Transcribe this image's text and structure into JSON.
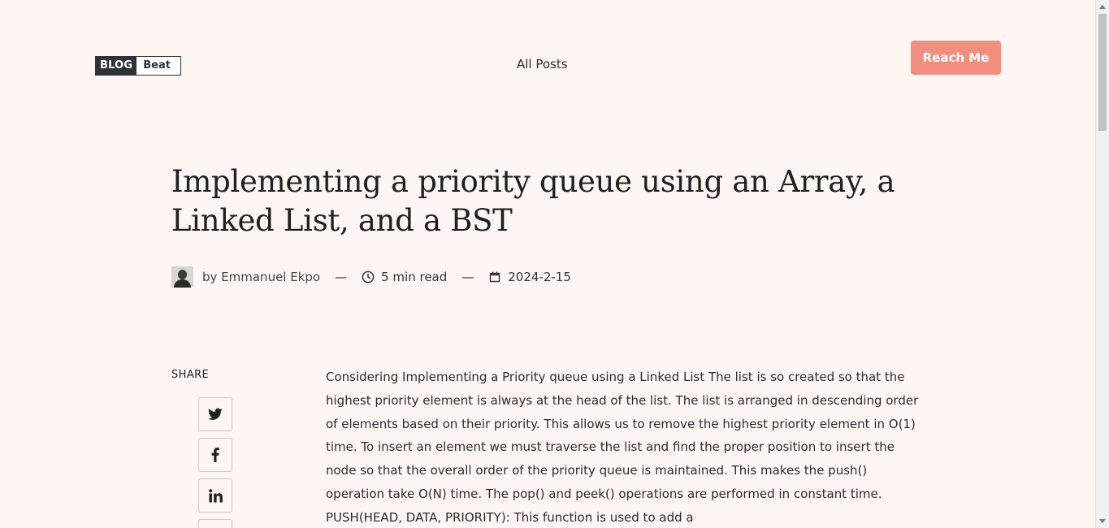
{
  "header": {
    "logo_part1": "BLOG",
    "logo_part2": "Beat",
    "nav_all_posts": "All Posts",
    "reach_button": "Reach Me"
  },
  "post": {
    "title": "Implementing a priority queue using an Array, a Linked List, and a BST",
    "author": "by Emmanuel Ekpo",
    "separator": "—",
    "read_time": "5 min read",
    "date": "2024-2-15",
    "body": "Considering Implementing a Priority queue using a Linked List The list is so created so that the highest priority element is always at the head of the list. The list is arranged in descending order of elements based on their priority. This allows us to remove the highest priority element in O(1) time. To insert an element we must traverse the list and find the proper position to insert the node so that the overall order of the priority queue is maintained. This makes the push() operation take O(N) time. The pop() and peek() operations are performed in constant time. PUSH(HEAD, DATA, PRIORITY): This function is used to add a"
  },
  "share": {
    "label": "SHARE",
    "icons": [
      "twitter-icon",
      "facebook-icon",
      "linkedin-icon"
    ]
  },
  "colors": {
    "background": "#fdf6f2",
    "accent": "#f28e7f",
    "logo_dark": "#2e3338"
  }
}
